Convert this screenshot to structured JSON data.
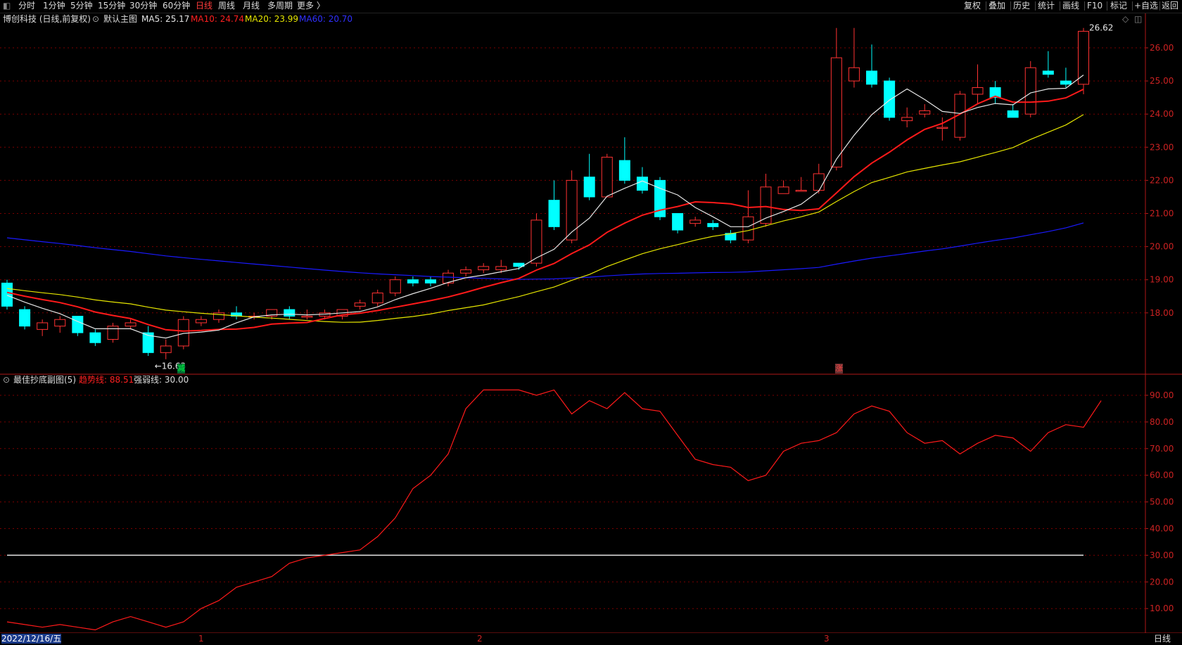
{
  "toolbar": {
    "timeframes": [
      "分时",
      "1分钟",
      "5分钟",
      "15分钟",
      "30分钟",
      "60分钟",
      "日线",
      "周线",
      "月线",
      "多周期",
      "更多 〉"
    ],
    "active_timeframe": "日线",
    "right_buttons": [
      "复权",
      "叠加",
      "历史",
      "统计",
      "画线",
      "F10",
      "标记",
      "+自选",
      "返回"
    ]
  },
  "main_chart": {
    "title": "博创科技 (日线,前复权)",
    "main_label": "默认主图",
    "ma": [
      {
        "label": "MA5: 25.17",
        "color": "#ffffff"
      },
      {
        "label": "MA10: 24.74",
        "color": "#ff2020"
      },
      {
        "label": "MA20: 23.99",
        "color": "#ffff00"
      },
      {
        "label": "MA60: 20.70",
        "color": "#2020ff"
      }
    ],
    "y_ticks": [
      "26.00",
      "25.00",
      "24.00",
      "23.00",
      "22.00",
      "21.00",
      "20.00",
      "19.00",
      "18.00"
    ],
    "y_tick_values": [
      26,
      25,
      24,
      23,
      22,
      21,
      20,
      19,
      18
    ],
    "high_label": "26.62",
    "low_label": "←16.63",
    "marker_reduce": "减",
    "marker_gain": "涨",
    "candles": [
      [
        18.9,
        18.2,
        19.0,
        18.1
      ],
      [
        18.1,
        17.6,
        18.2,
        17.5
      ],
      [
        17.5,
        17.7,
        17.8,
        17.3
      ],
      [
        17.6,
        17.8,
        17.9,
        17.4
      ],
      [
        17.9,
        17.4,
        17.9,
        17.3
      ],
      [
        17.4,
        17.1,
        17.5,
        17.0
      ],
      [
        17.2,
        17.6,
        17.7,
        17.1
      ],
      [
        17.6,
        17.7,
        17.8,
        17.5
      ],
      [
        17.4,
        16.8,
        17.6,
        16.7
      ],
      [
        16.8,
        17.0,
        17.2,
        16.6
      ],
      [
        17.0,
        17.8,
        17.9,
        16.9
      ],
      [
        17.7,
        17.8,
        17.9,
        17.6
      ],
      [
        17.8,
        18.0,
        18.1,
        17.7
      ],
      [
        18.0,
        17.9,
        18.2,
        17.8
      ],
      [
        17.9,
        17.9,
        18.0,
        17.8
      ],
      [
        17.9,
        18.1,
        18.1,
        17.8
      ],
      [
        18.1,
        17.9,
        18.2,
        17.8
      ],
      [
        17.9,
        17.9,
        18.1,
        17.8
      ],
      [
        17.9,
        18.0,
        18.1,
        17.8
      ],
      [
        17.9,
        18.1,
        18.1,
        17.8
      ],
      [
        18.2,
        18.3,
        18.4,
        18.1
      ],
      [
        18.3,
        18.6,
        18.7,
        18.2
      ],
      [
        18.6,
        19.0,
        19.1,
        18.5
      ],
      [
        19.0,
        18.9,
        19.1,
        18.8
      ],
      [
        19.0,
        18.9,
        19.1,
        18.8
      ],
      [
        18.9,
        19.2,
        19.3,
        18.8
      ],
      [
        19.2,
        19.3,
        19.4,
        19.1
      ],
      [
        19.3,
        19.4,
        19.5,
        19.2
      ],
      [
        19.3,
        19.4,
        19.6,
        19.2
      ],
      [
        19.5,
        19.4,
        19.5,
        19.3
      ],
      [
        19.5,
        20.8,
        21.0,
        19.4
      ],
      [
        21.4,
        20.6,
        22.0,
        20.5
      ],
      [
        20.2,
        22.0,
        22.3,
        20.1
      ],
      [
        22.1,
        21.5,
        22.8,
        21.4
      ],
      [
        21.5,
        22.7,
        22.8,
        21.5
      ],
      [
        22.6,
        22.0,
        23.3,
        21.9
      ],
      [
        22.1,
        21.7,
        22.4,
        21.6
      ],
      [
        22.0,
        20.9,
        22.1,
        20.8
      ],
      [
        21.0,
        20.5,
        21.0,
        20.4
      ],
      [
        20.7,
        20.8,
        20.9,
        20.6
      ],
      [
        20.7,
        20.6,
        20.8,
        20.5
      ],
      [
        20.4,
        20.2,
        20.5,
        20.1
      ],
      [
        20.2,
        20.9,
        21.7,
        20.1
      ],
      [
        20.7,
        21.8,
        22.2,
        20.6
      ],
      [
        21.6,
        21.8,
        22.0,
        21.6
      ],
      [
        21.7,
        21.7,
        22.1,
        21.7
      ],
      [
        21.7,
        22.2,
        22.5,
        21.6
      ],
      [
        22.4,
        25.7,
        26.6,
        22.3
      ],
      [
        25.0,
        25.4,
        26.6,
        24.8
      ],
      [
        25.3,
        24.9,
        26.1,
        24.8
      ],
      [
        25.0,
        23.9,
        25.1,
        23.8
      ],
      [
        23.8,
        23.9,
        24.2,
        23.6
      ],
      [
        24.0,
        24.1,
        24.3,
        23.9
      ],
      [
        23.6,
        23.6,
        23.9,
        23.2
      ],
      [
        23.3,
        24.6,
        24.7,
        23.2
      ],
      [
        24.6,
        24.8,
        25.5,
        24.3
      ],
      [
        24.8,
        24.5,
        25.0,
        24.3
      ],
      [
        24.1,
        23.9,
        24.3,
        23.9
      ],
      [
        24.0,
        25.4,
        25.6,
        23.9
      ],
      [
        25.3,
        25.2,
        25.9,
        25.1
      ],
      [
        25.0,
        24.9,
        25.4,
        24.8
      ],
      [
        24.9,
        26.5,
        26.6,
        24.6
      ]
    ]
  },
  "sub_chart": {
    "title": "最佳抄底副图(5)",
    "trend_label": "趋势线: 88.51",
    "strong_label": "强弱线: 30.00",
    "y_ticks": [
      "90.00",
      "80.00",
      "70.00",
      "60.00",
      "50.00",
      "40.00",
      "30.00",
      "20.00",
      "10.00"
    ],
    "y_tick_values": [
      90,
      80,
      70,
      60,
      50,
      40,
      30,
      20,
      10
    ],
    "strong_value": 30,
    "trend": [
      5,
      4,
      3,
      4,
      3,
      2,
      5,
      7,
      5,
      3,
      5,
      10,
      13,
      18,
      20,
      22,
      27,
      29,
      30,
      31,
      32,
      37,
      44,
      55,
      60,
      68,
      85,
      92,
      92,
      92,
      90,
      92,
      83,
      88,
      85,
      91,
      85,
      84,
      75,
      66,
      64,
      63,
      58,
      60,
      69,
      72,
      73,
      76,
      83,
      86,
      84,
      76,
      72,
      73,
      68,
      72,
      75,
      74,
      69,
      76,
      79,
      78,
      88
    ]
  },
  "bottom": {
    "date_label": "2022/12/16/五",
    "month_marks": [
      "1",
      "2",
      "3"
    ],
    "period": "日线"
  },
  "colors": {
    "up": "#ff3232",
    "down": "#00ffff",
    "ma5": "#e6e6e6",
    "ma10": "#ff1a1a",
    "ma20": "#e6e600",
    "ma60": "#1a1aff",
    "grid": "#7a0000",
    "border": "#b01818"
  }
}
